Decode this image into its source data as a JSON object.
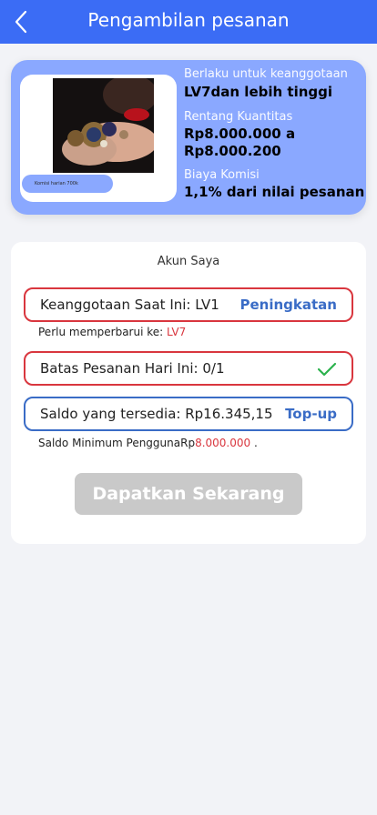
{
  "header": {
    "title": "Pengambilan pesanan",
    "back_icon": "chevron-left-icon"
  },
  "card": {
    "badge": "Komisi harian 700k",
    "membership_label": "Berlaku untuk keanggotaan",
    "membership_value": "LV7dan lebih tinggi",
    "range_label": "Rentang Kuantitas",
    "range_value": "Rp8.000.000 a Rp8.000.200",
    "commission_label": "Biaya Komisi",
    "commission_value": "1,1% dari nilai pesanan"
  },
  "account": {
    "title": "Akun Saya",
    "membership_text": "Keanggotaan Saat Ini: LV1",
    "upgrade_label": "Peningkatan",
    "upgrade_note_prefix": "Perlu memperbarui ke: ",
    "upgrade_note_level": "LV7",
    "order_limit_text": "Batas Pesanan Hari Ini: 0/1",
    "balance_text": "Saldo yang tersedia: Rp16.345,15",
    "topup_label": "Top-up",
    "min_balance_prefix": "Saldo Minimum PenggunaRp",
    "min_balance_value": "8.000.000",
    "min_balance_suffix": " ."
  },
  "cta": {
    "label": "Dapatkan Sekarang"
  },
  "colors": {
    "header": "#3b6cf5",
    "card": "#8aa8ff",
    "accent_red": "#d9363e",
    "accent_blue": "#3a6cc6",
    "check": "#2bb24c"
  }
}
